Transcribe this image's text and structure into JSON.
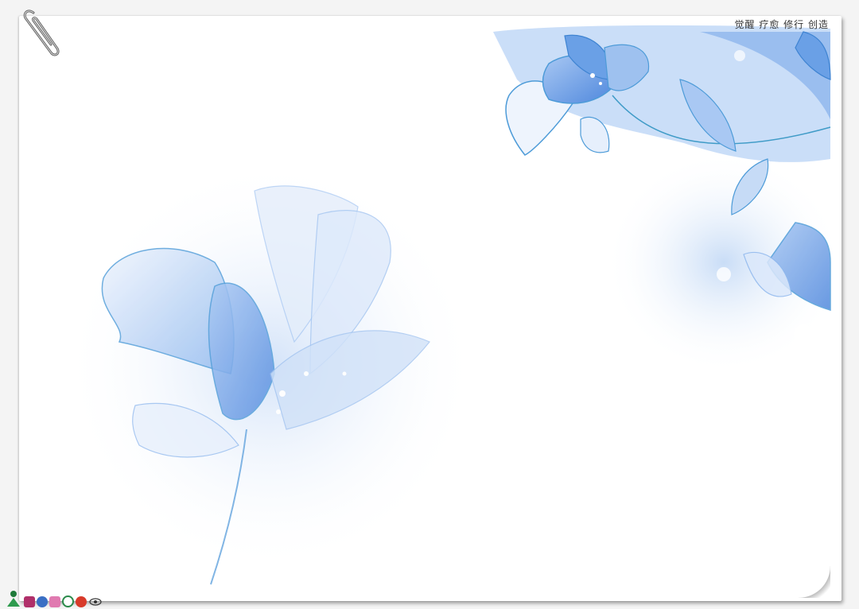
{
  "header": {
    "tagline": "觉醒 疗愈 修行 创造"
  },
  "colors": {
    "petal_light": "#dbe8fb",
    "petal_mid": "#9ec1ef",
    "petal_deep": "#5f97e3",
    "outline": "#4d9bd8",
    "background": "#ffffff"
  },
  "icons": {
    "clip": "paperclip-icon",
    "bottom_strip": [
      "person-icon",
      "heart-icon",
      "globe-icon",
      "image-icon",
      "circle-icon",
      "flower-icon",
      "eye-icon"
    ]
  }
}
